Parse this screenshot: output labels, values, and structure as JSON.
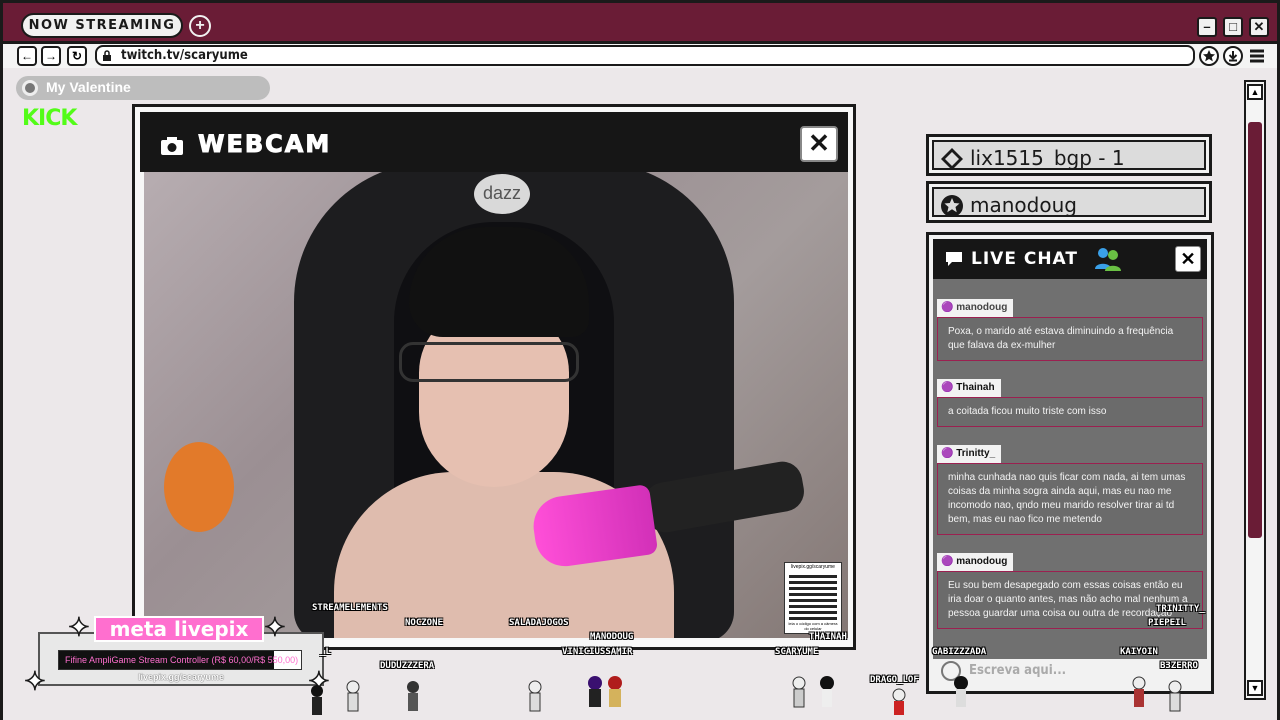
{
  "browser": {
    "now_streaming": "NOW STREAMING",
    "url": "twitch.tv/scaryume",
    "window_buttons": [
      "minimize-icon",
      "maximize-icon",
      "close-icon"
    ]
  },
  "now_playing": {
    "title": "My Valentine"
  },
  "platform_badge": "KICK",
  "webcam": {
    "title": "WEBCAM",
    "close": "✕",
    "chair_logo": "dazz",
    "qr_top": "livepix.gg/scaryume",
    "qr_bottom": "leia o código com a câmera do celular"
  },
  "panels": [
    {
      "text": "lix1515_bgp - 1",
      "icon": "diamond-icon"
    },
    {
      "text": "manodoug",
      "icon": "star-icon"
    }
  ],
  "chat": {
    "title": "LIVE CHAT",
    "close": "✕",
    "placeholder": "Escreva aqui...",
    "messages": [
      {
        "author": "manodoug",
        "text": "Poxa, o marido até estava diminuindo a frequência que falava da ex-mulher"
      },
      {
        "author": "Thainah",
        "text": "a coitada ficou muito triste com isso"
      },
      {
        "author": "Trinitty_",
        "text": "minha cunhada nao quis ficar com nada, ai tem umas coisas da minha sogra ainda aqui, mas eu nao me incomodo nao, qndo meu marido resolver tirar ai td bem, mas eu nao fico me metendo"
      },
      {
        "author": "manodoug",
        "text": "Eu sou bem desapegado com essas coisas então eu iria doar o quanto antes, mas não acho mal nenhum a pessoa guardar uma coisa ou outra de recordação"
      }
    ]
  },
  "livepix": {
    "title": "meta livepix",
    "goal": "Fifine AmpliGame Stream Controller (R$ 60,00/R$ 550,00)",
    "url": "livepix.gg/scaryume",
    "progress": 0.109
  },
  "viewers": [
    "STREAMELEMENTS",
    "NOCZONE",
    "SALADAJOGOS",
    "MANODOUG",
    "THAINAH",
    "DUDUZZZERA",
    "VINICIUSSAMIR",
    "SCARYUME",
    "DRAGO_LOF",
    "GABIZZZADA",
    "KAIYOIN",
    "B3ZERRO",
    "TRINITTY_",
    "PIEPEIL",
    "_L"
  ]
}
